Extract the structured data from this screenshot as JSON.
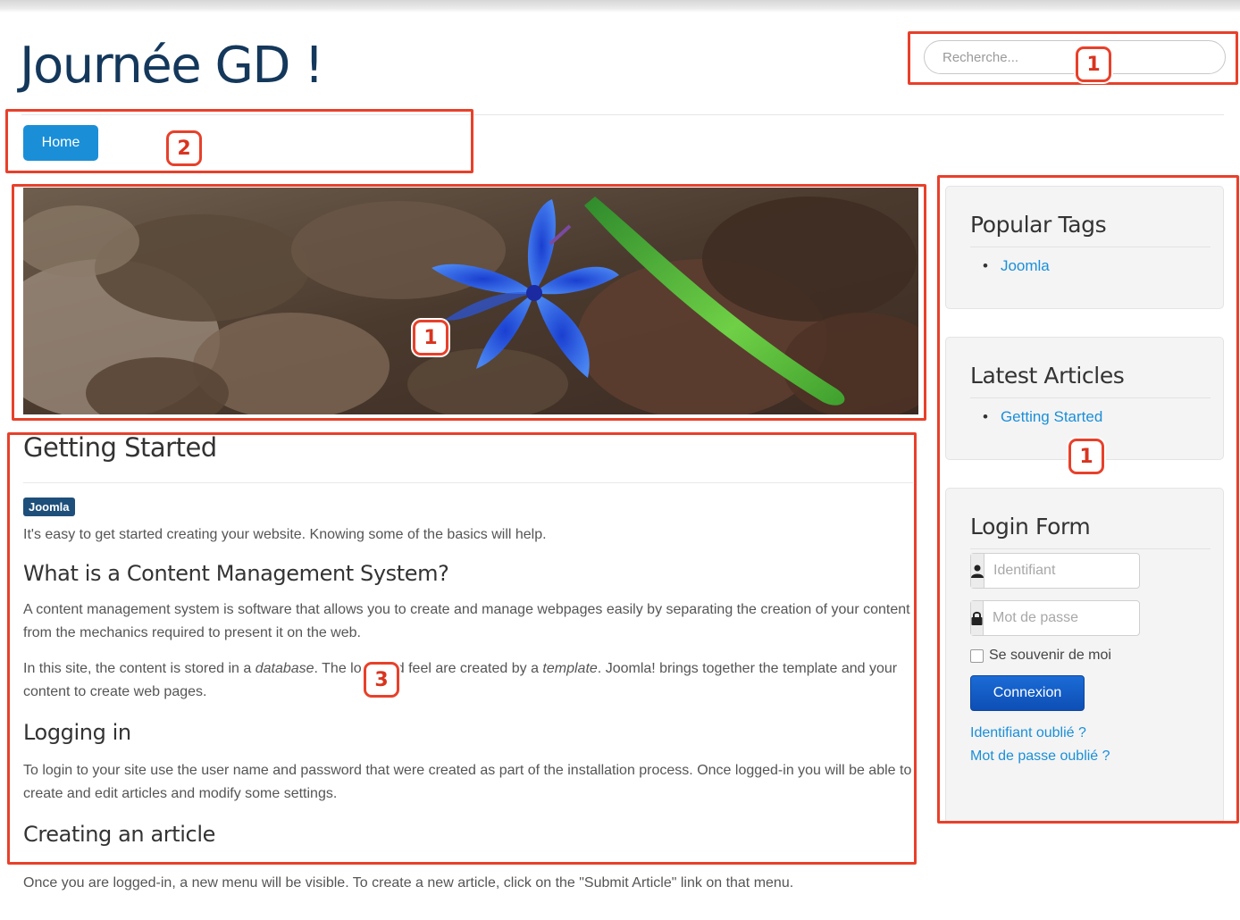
{
  "site": {
    "title": "Journée GD !"
  },
  "search": {
    "placeholder": "Recherche..."
  },
  "nav": {
    "home_label": "Home"
  },
  "article": {
    "title": "Getting Started",
    "tag": "Joomla",
    "intro": "It's easy to get started creating your website. Knowing some of the basics will help.",
    "h_cms": "What is a Content Management System?",
    "p_cms": "A content management system is software that allows you to create and manage webpages easily by separating the creation of your content from the mechanics required to present it on the web.",
    "p_site_1": "In this site, the content is stored in a ",
    "p_site_database": "database",
    "p_site_2": ". The look and feel are created by a ",
    "p_site_template": "template",
    "p_site_3": ". Joomla! brings together the template and your content to create web pages.",
    "h_login": "Logging in",
    "p_login": "To login to your site use the user name and password that were created as part of the installation process. Once logged-in you will be able to create and edit articles and modify some settings.",
    "h_create": "Creating an article",
    "p_create": "Once you are logged-in, a new menu will be visible. To create a new article, click on the \"Submit Article\" link on that menu."
  },
  "sidebar": {
    "popular_tags": {
      "title": "Popular Tags",
      "items": [
        "Joomla"
      ]
    },
    "latest_articles": {
      "title": "Latest Articles",
      "items": [
        "Getting Started"
      ]
    },
    "login": {
      "title": "Login Form",
      "username_placeholder": "Identifiant",
      "password_placeholder": "Mot de passe",
      "remember_label": "Se souvenir de moi",
      "submit_label": "Connexion",
      "forgot_username": "Identifiant oublié ?",
      "forgot_password": "Mot de passe oublié ?"
    }
  },
  "annotations": {
    "search": "1",
    "nav": "2",
    "banner": "1",
    "sidebar": "1",
    "content": "3",
    "color": "#e8402a"
  },
  "icons": {
    "username": "user-icon",
    "password": "lock-icon"
  }
}
